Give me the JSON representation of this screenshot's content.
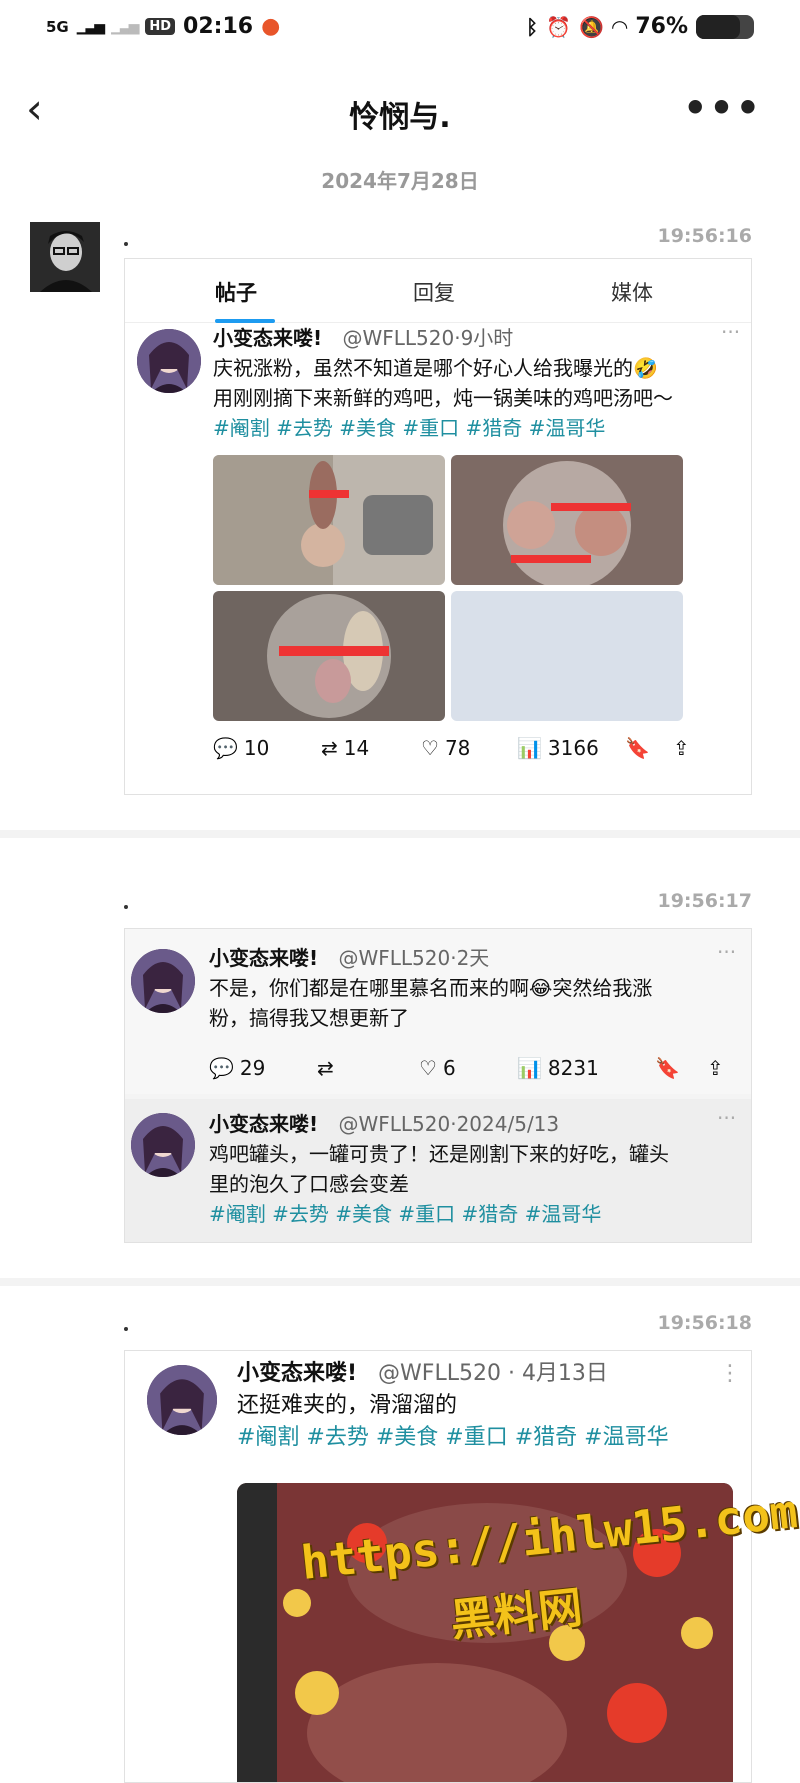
{
  "status": {
    "network": "5G",
    "hd": "HD",
    "time": "02:16",
    "battery": "76%",
    "battery_level": 0.76
  },
  "nav": {
    "title": "怜悯与."
  },
  "date": "2024年7月28日",
  "messages": [
    {
      "time": "19:56:16"
    },
    {
      "time": "19:56:17"
    },
    {
      "time": "19:56:18"
    }
  ],
  "card1": {
    "tabs": [
      "帖子",
      "回复",
      "媒体"
    ],
    "post": {
      "name": "小变态来喽!",
      "meta": "@WFLL520·9小时",
      "line1": "庆祝涨粉，虽然不知道是哪个好心人给我曝光的🤣",
      "line2": "用刚刚摘下来新鲜的鸡吧，炖一锅美味的鸡吧汤吧～",
      "tags": "#阉割 #去势 #美食 #重口 #猎奇 #温哥华",
      "replies": "10",
      "retweets": "14",
      "likes": "78",
      "views": "3166"
    }
  },
  "card2": {
    "post1": {
      "name": "小变态来喽!",
      "meta": "@WFLL520·2天",
      "line1": "不是，你们都是在哪里慕名而来的啊😂突然给我涨",
      "line2": "粉，搞得我又想更新了",
      "replies": "29",
      "likes": "6",
      "views": "8231"
    },
    "post2": {
      "name": "小变态来喽!",
      "meta": "@WFLL520·2024/5/13",
      "line1": "鸡吧罐头，一罐可贵了！还是刚割下来的好吃，罐头",
      "line2": "里的泡久了口感会变差",
      "tags": "#阉割 #去势 #美食 #重口 #猎奇 #温哥华"
    }
  },
  "card3": {
    "post": {
      "name": "小变态来喽!",
      "meta": "@WFLL520 · 4月13日",
      "line1": "还挺难夹的，滑溜溜的",
      "tags": "#阉割 #去势 #美食 #重口 #猎奇 #温哥华"
    }
  },
  "watermark": {
    "url": "https://ihlw15.com",
    "name": "黑料网"
  }
}
